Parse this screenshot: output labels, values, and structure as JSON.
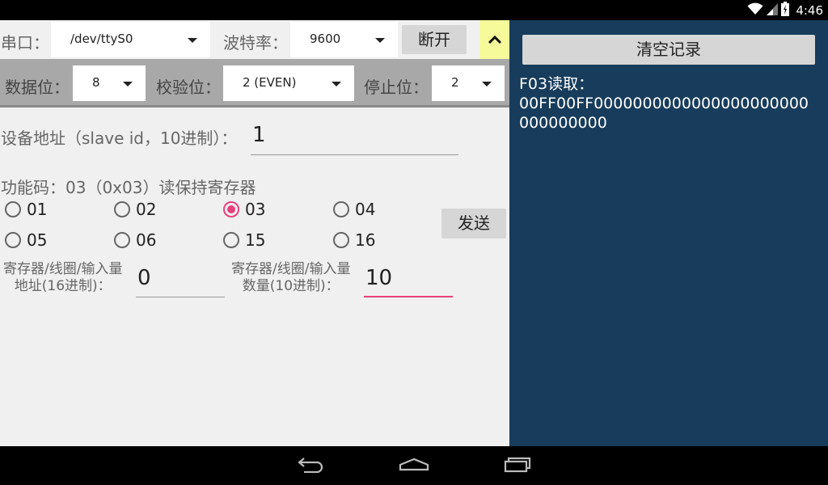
{
  "status_bar": {
    "time": "4:46",
    "icons": [
      "wifi-icon",
      "signal-icon",
      "battery-icon"
    ]
  },
  "serial": {
    "port_label": "串口：",
    "port_value": "/dev/ttyS0",
    "baud_label": "波特率：",
    "baud_value": "9600",
    "disconnect_label": "断开",
    "collapse_icon": "chevron-up-icon",
    "data_bits_label": "数据位：",
    "data_bits_value": "8",
    "parity_label": "校验位：",
    "parity_value": "2 (EVEN)",
    "stop_bits_label": "停止位：",
    "stop_bits_value": "2"
  },
  "slave": {
    "label": "设备地址（slave id，10进制）：",
    "value": "1"
  },
  "function": {
    "label": "功能码：03（0x03）读保持寄存器",
    "options": [
      "01",
      "02",
      "03",
      "04",
      "05",
      "06",
      "15",
      "16"
    ],
    "selected": "03",
    "send_label": "发送"
  },
  "register": {
    "address_label_line1": "寄存器/线圈/输入量",
    "address_label_line2": "地址(16进制)：",
    "address_value": "0",
    "count_label_line1": "寄存器/线圈/输入量",
    "count_label_line2": "数量(10进制)：",
    "count_value": "10"
  },
  "log": {
    "clear_label": "清空记录",
    "title": "F03读取：",
    "content": "00FF00FF0000000000000000000000000000000"
  },
  "colors": {
    "accent": "#e8407a",
    "right_panel": "#173c5c",
    "collapse_bg": "#f6fa9a"
  },
  "nav_bar": {
    "icons": [
      "back-icon",
      "home-icon",
      "recents-icon"
    ]
  }
}
